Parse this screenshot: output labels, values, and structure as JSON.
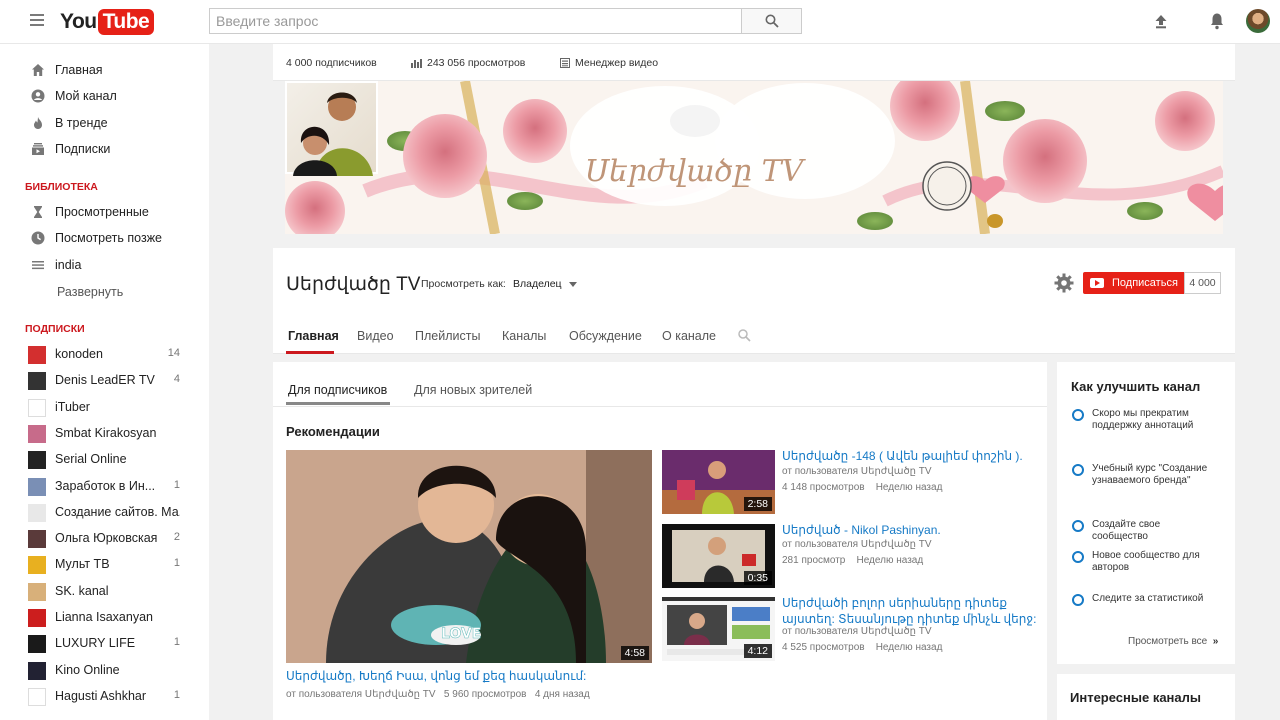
{
  "header": {
    "logo_you": "You",
    "logo_tube": "Tube",
    "search_placeholder": "Введите запрос"
  },
  "sidebar": {
    "nav": [
      {
        "label": "Главная",
        "icon": "home-icon"
      },
      {
        "label": "Мой канал",
        "icon": "account-icon"
      },
      {
        "label": "В тренде",
        "icon": "flame-icon"
      },
      {
        "label": "Подписки",
        "icon": "subscriptions-icon"
      }
    ],
    "library_heading": "БИБЛИОТЕКА",
    "library": [
      {
        "label": "Просмотренные",
        "icon": "hourglass-icon"
      },
      {
        "label": "Посмотреть позже",
        "icon": "clock-icon"
      },
      {
        "label": "india",
        "icon": "playlist-icon"
      }
    ],
    "expand_label": "Развернуть",
    "subs_heading": "ПОДПИСКИ",
    "subscriptions": [
      {
        "name": "konoden",
        "count": "14",
        "color": "#d32f2f"
      },
      {
        "name": "Denis LeadER TV",
        "count": "4",
        "color": "#333333"
      },
      {
        "name": "iTuber",
        "count": "",
        "color": "#ffffff"
      },
      {
        "name": "Smbat Kirakosyan",
        "count": "",
        "color": "#c76b8a"
      },
      {
        "name": "Serial Online",
        "count": "",
        "color": "#222222"
      },
      {
        "name": "Заработок в Ин...",
        "count": "1",
        "color": "#7a8fb5"
      },
      {
        "name": "Создание сайтов. Ма...",
        "count": "",
        "color": "#e8e8e8"
      },
      {
        "name": "Ольга Юрковская",
        "count": "2",
        "color": "#5a3a3a"
      },
      {
        "name": "Мульт ТВ",
        "count": "1",
        "color": "#e8b020"
      },
      {
        "name": "SK. kanal",
        "count": "",
        "color": "#d8b07a"
      },
      {
        "name": "Lianna Isaxanyan",
        "count": "",
        "color": "#cc1e1e"
      },
      {
        "name": "LUXURY LIFE",
        "count": "1",
        "color": "#1a1a1a"
      },
      {
        "name": "Kino Online",
        "count": "",
        "color": "#222233"
      },
      {
        "name": "Hagusti Ashkhar",
        "count": "1",
        "color": "#ffffff"
      }
    ]
  },
  "channel": {
    "subscribers": "4 000 подписчиков",
    "views": "243 056 просмотров",
    "video_manager": "Менеджер видео",
    "name": "Սերժվածը TV",
    "view_as_label": "Просмотреть как:",
    "view_as_value": "Владелец",
    "subscribe_label": "Подписаться",
    "subscribe_count": "4 000",
    "tabs": [
      "Главная",
      "Видео",
      "Плейлисты",
      "Каналы",
      "Обсуждение",
      "О канале"
    ]
  },
  "content": {
    "tabs": [
      "Для подписчиков",
      "Для новых зрителей"
    ],
    "section_title": "Рекомендации",
    "featured": {
      "title": "Սերժվածը, Խեղճ Իսա, վոնց եմ քեզ հասկանում:",
      "author": "от пользователя Սերժվածը TV",
      "views": "5 960 просмотров",
      "age": "4 дня назад",
      "duration": "4:58"
    },
    "videos": [
      {
        "title": "Սերժվածը -148 ( Ավեն թալիեմ փոշին ).",
        "author": "от пользователя Սերժվածը TV",
        "views": "4 148 просмотров",
        "age": "Неделю назад",
        "duration": "2:58"
      },
      {
        "title": "Սերժված - Nikol Pashinyan.",
        "author": "от пользователя Սերժվածը TV",
        "views": "281 просмотр",
        "age": "Неделю назад",
        "duration": "0:35"
      },
      {
        "title": "Սերժվածի բոլոր սերիաները դիտեք այստեղ: Տեսանյութը դիտեք մինչև վերջ:",
        "author": "от пользователя Սերժվածը TV",
        "views": "4 525 просмотров",
        "age": "Неделю назад",
        "duration": "4:12"
      }
    ]
  },
  "improve": {
    "title": "Как улучшить канал",
    "tips": [
      "Скоро мы прекратим поддержку аннотаций",
      "Учебный курс \"Создание узнаваемого бренда\"",
      "Создайте свое сообщество",
      "Новое сообщество для авторов",
      "Следите за статистикой"
    ],
    "see_all": "Просмотреть все",
    "see_all_arrow": "»"
  },
  "interesting": {
    "title": "Интересные каналы"
  },
  "colors": {
    "brand_red": "#e62117",
    "section_red": "#cc181e",
    "link_blue": "#167ac6"
  }
}
